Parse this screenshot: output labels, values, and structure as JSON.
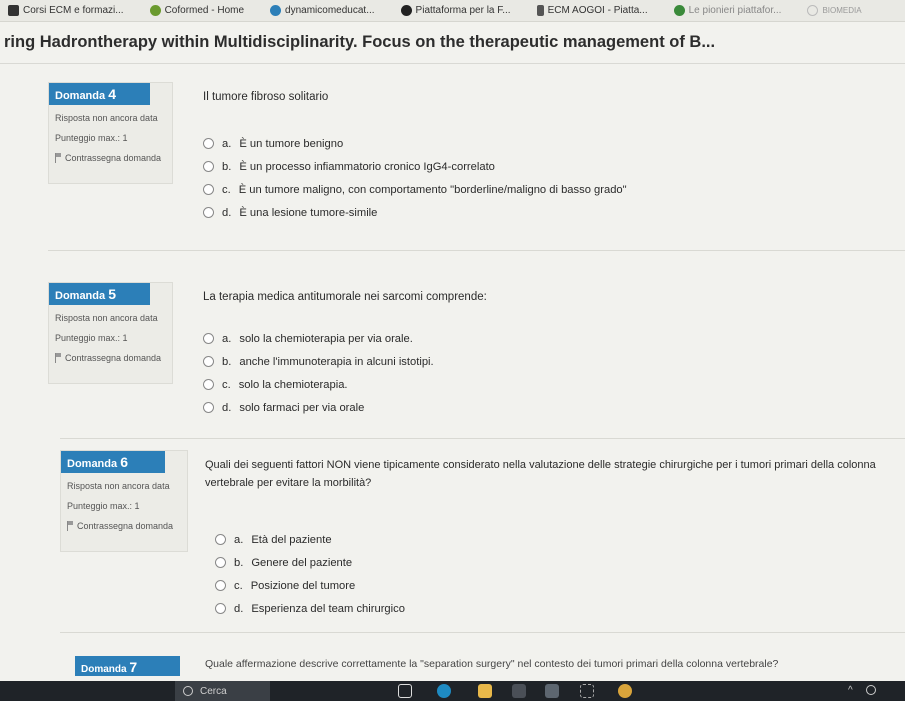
{
  "bookmarks": [
    {
      "label": "Corsi ECM e formazi...",
      "color": "#333333"
    },
    {
      "label": "Coformed - Home",
      "color": "#6a9a2e"
    },
    {
      "label": "dynamicomeducat...",
      "color": "#2c7fb8"
    },
    {
      "label": "Piattaforma per la F...",
      "color": "#222222"
    },
    {
      "label": "ECM AOGOI - Piatta...",
      "color": "#555555"
    },
    {
      "label": "Le pionieri piattafor...",
      "color": "#3a8a3a"
    },
    {
      "label": "BIOMEDIA",
      "color": "#999999"
    }
  ],
  "page_title": "ring Hadrontherapy within Multidisciplinarity. Focus on the therapeutic management of B...",
  "questions": [
    {
      "label": "Domanda",
      "number": "4",
      "status": "Risposta non ancora data",
      "score": "Punteggio max.: 1",
      "flag": "Contrassegna domanda",
      "text": "Il tumore fibroso solitario",
      "answers": [
        {
          "letter": "a.",
          "text": "È un tumore benigno"
        },
        {
          "letter": "b.",
          "text": "È un processo infiammatorio cronico IgG4-correlato"
        },
        {
          "letter": "c.",
          "text": "È un tumore maligno, con comportamento \"borderline/maligno di basso grado\""
        },
        {
          "letter": "d.",
          "text": "È una lesione tumore-simile"
        }
      ]
    },
    {
      "label": "Domanda",
      "number": "5",
      "status": "Risposta non ancora data",
      "score": "Punteggio max.: 1",
      "flag": "Contrassegna domanda",
      "text": "La terapia medica antitumorale nei sarcomi comprende:",
      "answers": [
        {
          "letter": "a.",
          "text": "solo la chemioterapia per via orale."
        },
        {
          "letter": "b.",
          "text": "anche l'immunoterapia in alcuni istotipi."
        },
        {
          "letter": "c.",
          "text": "solo la chemioterapia."
        },
        {
          "letter": "d.",
          "text": "solo farmaci per via orale"
        }
      ]
    },
    {
      "label": "Domanda",
      "number": "6",
      "status": "Risposta non ancora data",
      "score": "Punteggio max.: 1",
      "flag": "Contrassegna domanda",
      "text": "Quali dei seguenti fattori NON viene tipicamente considerato nella valutazione delle strategie chirurgiche per i tumori primari della colonna vertebrale per evitare la morbilità?",
      "answers": [
        {
          "letter": "a.",
          "text": "Età del paziente"
        },
        {
          "letter": "b.",
          "text": "Genere del paziente"
        },
        {
          "letter": "c.",
          "text": "Posizione del tumore"
        },
        {
          "letter": "d.",
          "text": "Esperienza del team chirurgico"
        }
      ]
    },
    {
      "label": "Domanda",
      "number": "7",
      "text": "Quale affermazione descrive correttamente la \"separation surgery\" nel contesto dei tumori primari della colonna vertebrale?"
    }
  ],
  "taskbar": {
    "search_placeholder": "Cerca",
    "accent": "#2c7fb8"
  }
}
